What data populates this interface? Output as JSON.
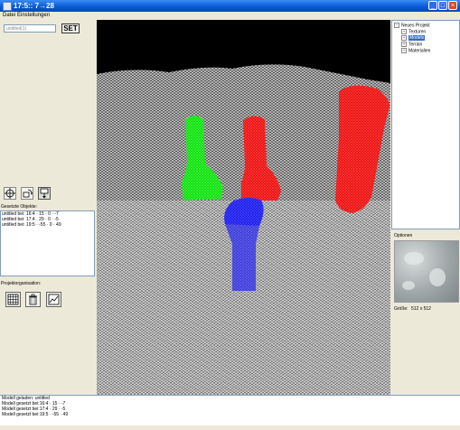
{
  "window": {
    "title": "17:5:: 7→28"
  },
  "menu": [
    "Datei",
    "Einstellungen"
  ],
  "left": {
    "name_input_value": "untitled(1)",
    "set_label": "SET",
    "placed_objects_label": "Gesetzte Objekte:",
    "placed_objects": [
      "untitled bei: 16:4 · 15 · 0 · -7",
      "untitled bei: 17:4 · 29 · 0 · -5",
      "untitled bei: 19:5 · -55 · 0 · 49"
    ],
    "project_org_label": "Projektorganisation:"
  },
  "tree": {
    "root": "Neues Projekt",
    "children": [
      "Texturen",
      "Models",
      "Terrain",
      "Materialien"
    ],
    "selected": "Models"
  },
  "options": {
    "title": "Optionen",
    "size_label": "Größe:",
    "size_value": "512 x 512"
  },
  "log": [
    "Modell geladen: untitled",
    "Modell gesetzt bei:16:4 · 15 · -7",
    "Modell gesetzt bei:17:4 · 29 · -5",
    "Modell gesetzt bei:19:5 · -55 · 49"
  ],
  "colors": {
    "model_green": "#00ff00",
    "model_red": "#ff0000",
    "model_blue": "#1a1aff",
    "terrain_wire": "#e8e8e8",
    "selection_blue": "#316ac5"
  },
  "icons": {
    "crosshair": "move-crosshair-icon",
    "rotate": "rotate-object-icon",
    "place": "place-object-icon",
    "grid": "grid-icon",
    "delete": "trash-icon",
    "graph": "graph-icon"
  }
}
